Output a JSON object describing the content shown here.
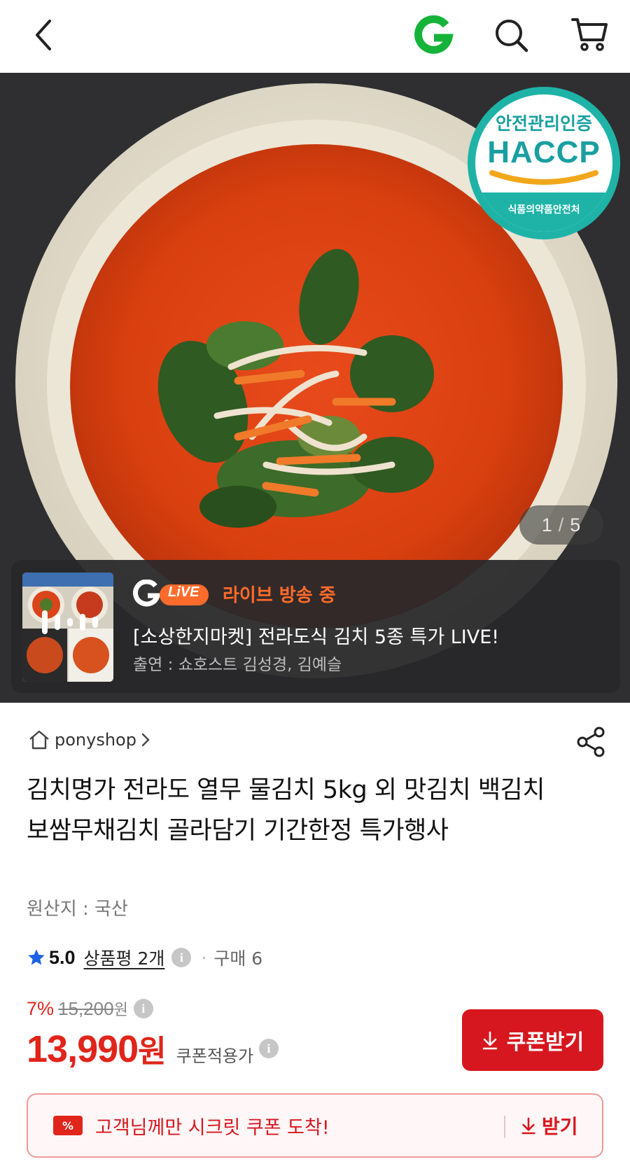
{
  "header": {
    "back_icon": "chevron-left-icon",
    "logo_text": "G",
    "logo_color": "#16b33a",
    "search_icon": "search-icon",
    "cart_icon": "cart-icon"
  },
  "hero": {
    "pager_current": "1",
    "pager_total": "5",
    "badge": {
      "top": "안전관리인증",
      "main": "HACCP",
      "bottom": "식품의약품안전처",
      "color": "#1fb3a7"
    }
  },
  "live": {
    "logo_letter": "G",
    "logo_badge": "LiVE",
    "status": "라이브 방송 중",
    "title": "[소상한지마켓] 전라도식 김치 5종 특가 LIVE!",
    "cast": "출연 : 쇼호스트 김성경, 김예슬",
    "accent_color": "#ff6b2b"
  },
  "product": {
    "shop_name": "ponyshop",
    "title": "김치명가 전라도 열무 물김치 5kg 외 맛김치 백김치 보쌈무채김치 골라담기 기간한정 특가행사",
    "origin": "원산지 : 국산",
    "rating": "5.0",
    "review_label": "상품평 2개",
    "purchase_label": "구매 6",
    "info_glyph": "i",
    "discount_rate": "7%",
    "original_price": "15,200",
    "original_currency": "원",
    "sale_price": "13,990",
    "sale_currency": "원",
    "coupon_applied_label": "쿠폰적용가",
    "coupon_button_label": "쿠폰받기",
    "price_color": "#e0251b"
  },
  "secret_coupon": {
    "icon_text": "%",
    "message": "고객님께만 시크릿 쿠폰 도착!",
    "receive_label": "받기"
  }
}
